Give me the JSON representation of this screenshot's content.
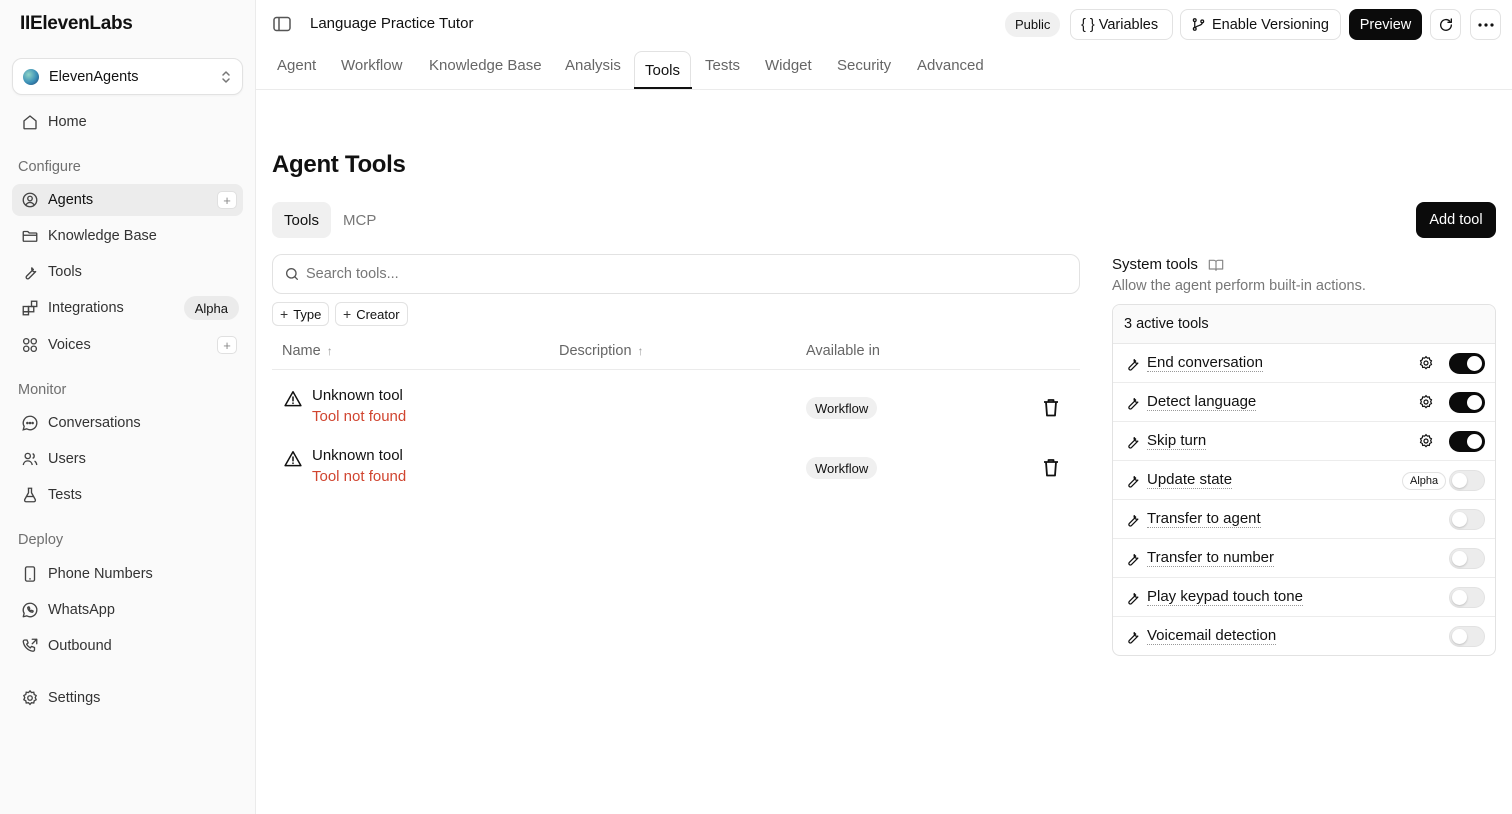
{
  "brand": {
    "logo": "IIElevenLabs"
  },
  "workspace": {
    "name": "ElevenAgents"
  },
  "sidebar": {
    "home": "Home",
    "sections": {
      "configure": "Configure",
      "monitor": "Monitor",
      "deploy": "Deploy"
    },
    "configure": [
      {
        "label": "Agents",
        "icon": "agent-icon",
        "active": true
      },
      {
        "label": "Knowledge Base",
        "icon": "folder-icon"
      },
      {
        "label": "Tools",
        "icon": "wrench-icon"
      },
      {
        "label": "Integrations",
        "icon": "blocks-icon",
        "badge": "Alpha"
      },
      {
        "label": "Voices",
        "icon": "voices-icon"
      }
    ],
    "monitor": [
      {
        "label": "Conversations",
        "icon": "chat-icon"
      },
      {
        "label": "Users",
        "icon": "users-icon"
      },
      {
        "label": "Tests",
        "icon": "flask-icon"
      }
    ],
    "deploy": [
      {
        "label": "Phone Numbers",
        "icon": "phone-icon"
      },
      {
        "label": "WhatsApp",
        "icon": "whatsapp-icon"
      },
      {
        "label": "Outbound",
        "icon": "outbound-call-icon"
      }
    ],
    "settings": "Settings"
  },
  "header": {
    "agent_name": "Language Practice Tutor",
    "visibility": "Public",
    "variables": "{ } Variables",
    "versioning": "Enable Versioning",
    "preview": "Preview"
  },
  "tabs": [
    "Agent",
    "Workflow",
    "Knowledge Base",
    "Analysis",
    "Tools",
    "Tests",
    "Widget",
    "Security",
    "Advanced"
  ],
  "active_tab": "Tools",
  "main": {
    "title": "Agent Tools",
    "segments": [
      "Tools",
      "MCP"
    ],
    "add_tool": "Add tool",
    "search_placeholder": "Search tools...",
    "filters": [
      "Type",
      "Creator"
    ],
    "columns": [
      "Name",
      "Description",
      "Available in"
    ],
    "rows": [
      {
        "name": "Unknown tool",
        "error": "Tool not found",
        "available_in": "Workflow"
      },
      {
        "name": "Unknown tool",
        "error": "Tool not found",
        "available_in": "Workflow"
      }
    ]
  },
  "system_tools": {
    "title": "System tools",
    "subtitle": "Allow the agent perform built-in actions.",
    "active_count": "3 active tools",
    "items": [
      {
        "label": "End conversation",
        "enabled": true,
        "settings": true
      },
      {
        "label": "Detect language",
        "enabled": true,
        "settings": true
      },
      {
        "label": "Skip turn",
        "enabled": true,
        "settings": true
      },
      {
        "label": "Update state",
        "enabled": false,
        "badge": "Alpha"
      },
      {
        "label": "Transfer to agent",
        "enabled": false
      },
      {
        "label": "Transfer to number",
        "enabled": false
      },
      {
        "label": "Play keypad touch tone",
        "enabled": false
      },
      {
        "label": "Voicemail detection",
        "enabled": false
      }
    ]
  },
  "colors": {
    "accent": "#0b0b0b",
    "error": "#d04530",
    "sidebar_bg": "#fafafa"
  }
}
